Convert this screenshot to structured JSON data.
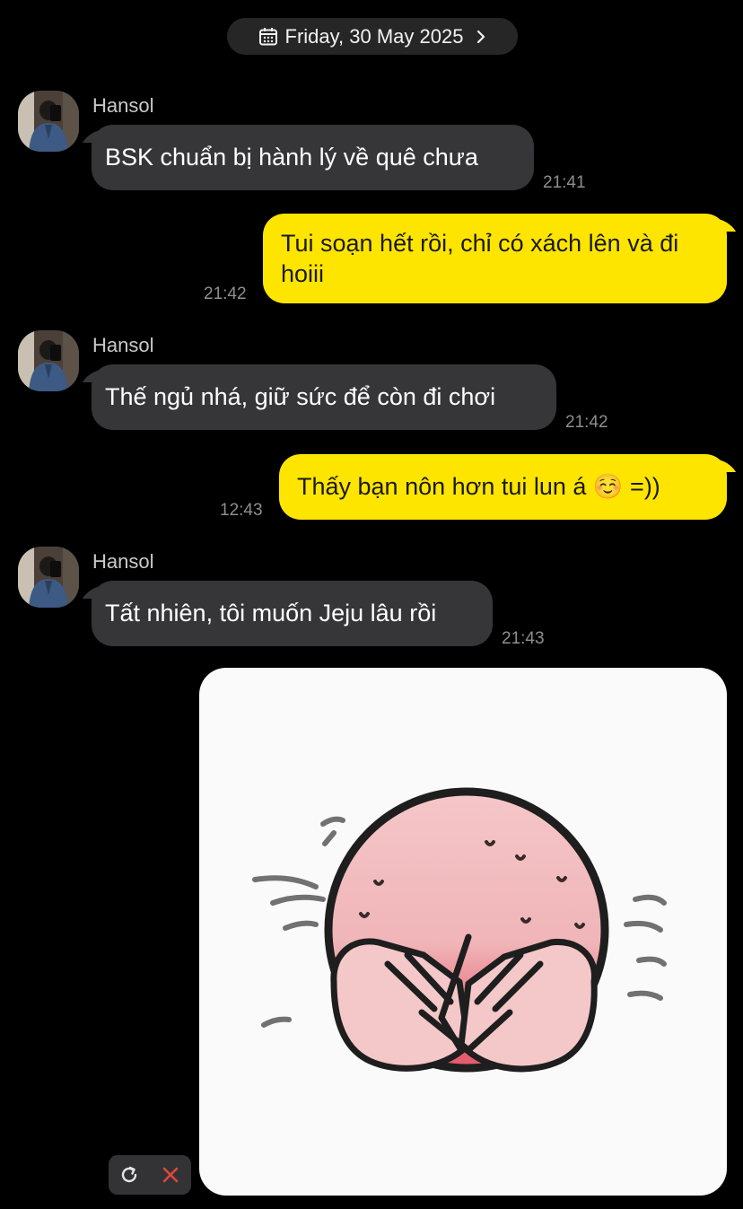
{
  "date_header": {
    "label": "Friday, 30 May 2025",
    "icon": "calendar-icon",
    "chevron": "chevron-right-icon"
  },
  "colors": {
    "background": "#000000",
    "incoming_bubble": "#363638",
    "outgoing_bubble": "#fee500",
    "timestamp": "#8e8e8e",
    "delete_red": "#e0473d"
  },
  "messages": [
    {
      "sender": "Hansol",
      "direction": "incoming",
      "text": "BSK chuẩn bị hành lý về quê chưa",
      "time": "21:41"
    },
    {
      "direction": "outgoing",
      "text": "Tui soạn hết rồi, chỉ có xách lên và đi hoiii",
      "time": "21:42"
    },
    {
      "sender": "Hansol",
      "direction": "incoming",
      "text": "Thế ngủ nhá, giữ sức để còn đi chơi",
      "time": "21:42"
    },
    {
      "direction": "outgoing",
      "text": "Thấy bạn nôn hơn tui lun á ☺️ =))",
      "time": "12:43"
    },
    {
      "sender": "Hansol",
      "direction": "incoming",
      "text": "Tất nhiên, tôi muốn Jeju lâu rồi",
      "time": "21:43"
    },
    {
      "direction": "outgoing",
      "type": "sticker",
      "sticker": "pink-blob-covering-face-sticker"
    }
  ],
  "failed_send_actions": {
    "retry_icon": "retry-icon",
    "delete_icon": "close-icon"
  }
}
